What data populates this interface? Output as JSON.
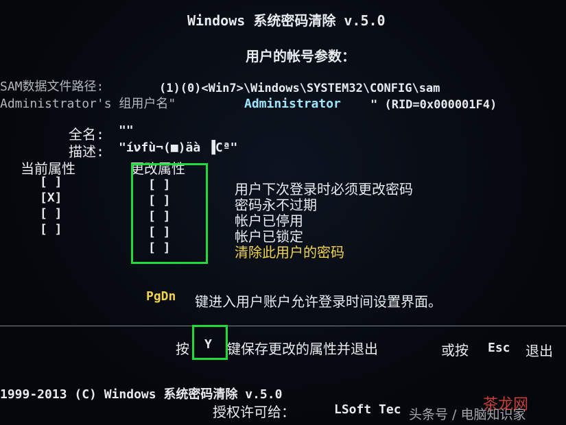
{
  "header": {
    "title": "Windows 系统密码清除 v.5.0",
    "subtitle": "用户的帐号参数："
  },
  "sam": {
    "path_label": "SAM数据文件路径:",
    "path_value": "(1)(0)<Win7>\\Windows\\SYSTEM32\\CONFIG\\sam",
    "group_label": "Administrator's 组用户名\"",
    "username": "Administrator",
    "rid": "\" (RID=0x000001F4)"
  },
  "info": {
    "fullname_label": "全名:",
    "fullname_value": "\"\"",
    "desc_label": "描述:",
    "desc_value": "\"íνfù¬(■)äà ▐Cª\""
  },
  "attributes": {
    "current_header": "当前属性",
    "change_header": "更改属性",
    "rows": [
      {
        "current": "[ ]",
        "change": "[ ]",
        "label": "用户下次登录时必须更改密码"
      },
      {
        "current": "[X]",
        "change": "[ ]",
        "label": "密码永不过期"
      },
      {
        "current": "[ ]",
        "change": "[ ]",
        "label": "帐户已停用"
      },
      {
        "current": "[ ]",
        "change": "[ ]",
        "label": "帐户已锁定"
      },
      {
        "current": "",
        "change": "[ ]",
        "label": "清除此用户的密码"
      }
    ]
  },
  "pgdn": {
    "key": "PgDn",
    "text": "键进入用户账户允许登录时间设置界面。"
  },
  "footer_action": {
    "press": "按",
    "key_y": "Y",
    "text": "键保存更改的属性并退出",
    "or": "或按",
    "key_esc": "Esc",
    "exit": "退出"
  },
  "copyright": {
    "line1": "1999-2013 (C) Windows 系统密码清除 v.5.0",
    "line2_label": "授权许可给：",
    "licensee": "LSoft Tec"
  },
  "watermark": {
    "text": "头条号 / 电脑知识家",
    "brand": "茶龙网"
  },
  "colors": {
    "highlight": "#1fdc3a",
    "accent": "#f2d44a"
  }
}
